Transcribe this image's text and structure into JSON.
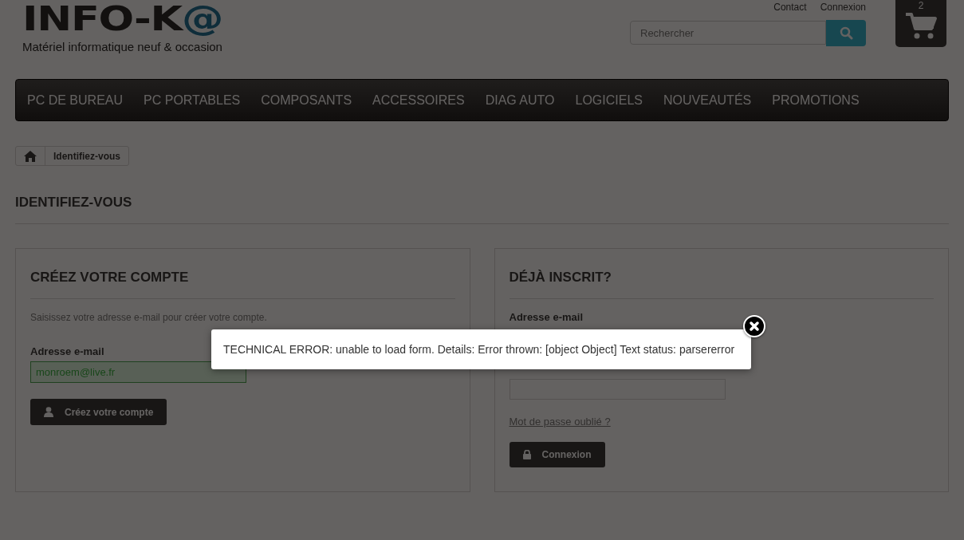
{
  "header": {
    "logo": {
      "name": "INFO-K",
      "at": "@",
      "tagline": "Matériel informatique neuf & occasion"
    },
    "links": [
      "Contact",
      "Connexion"
    ],
    "search": {
      "placeholder": "Rechercher"
    },
    "cart": {
      "count": "2"
    }
  },
  "menu": [
    "PC DE BUREAU",
    "PC PORTABLES",
    "COMPOSANTS",
    "ACCESSOIRES",
    "DIAG AUTO",
    "LOGICIELS",
    "NOUVEAUTÉS",
    "PROMOTIONS"
  ],
  "breadcrumb": [
    "Identifiez-vous"
  ],
  "page_title": "IDENTIFIEZ-VOUS",
  "create_account": {
    "title": "CRÉEZ VOTRE COMPTE",
    "intro": "Saisissez votre adresse e-mail pour créer votre compte.",
    "email_label": "Adresse e-mail",
    "email_value": "monroem@live.fr",
    "valid": true,
    "button": "Créez votre compte"
  },
  "login": {
    "title": "DÉJÀ INSCRIT?",
    "email_label": "Adresse e-mail",
    "forgot": "Mot de passe oublié ?",
    "button": "Connexion"
  },
  "dialog": {
    "message": "TECHNICAL ERROR: unable to load form. Details: Error thrown: [object Object] Text status: parsererror"
  }
}
